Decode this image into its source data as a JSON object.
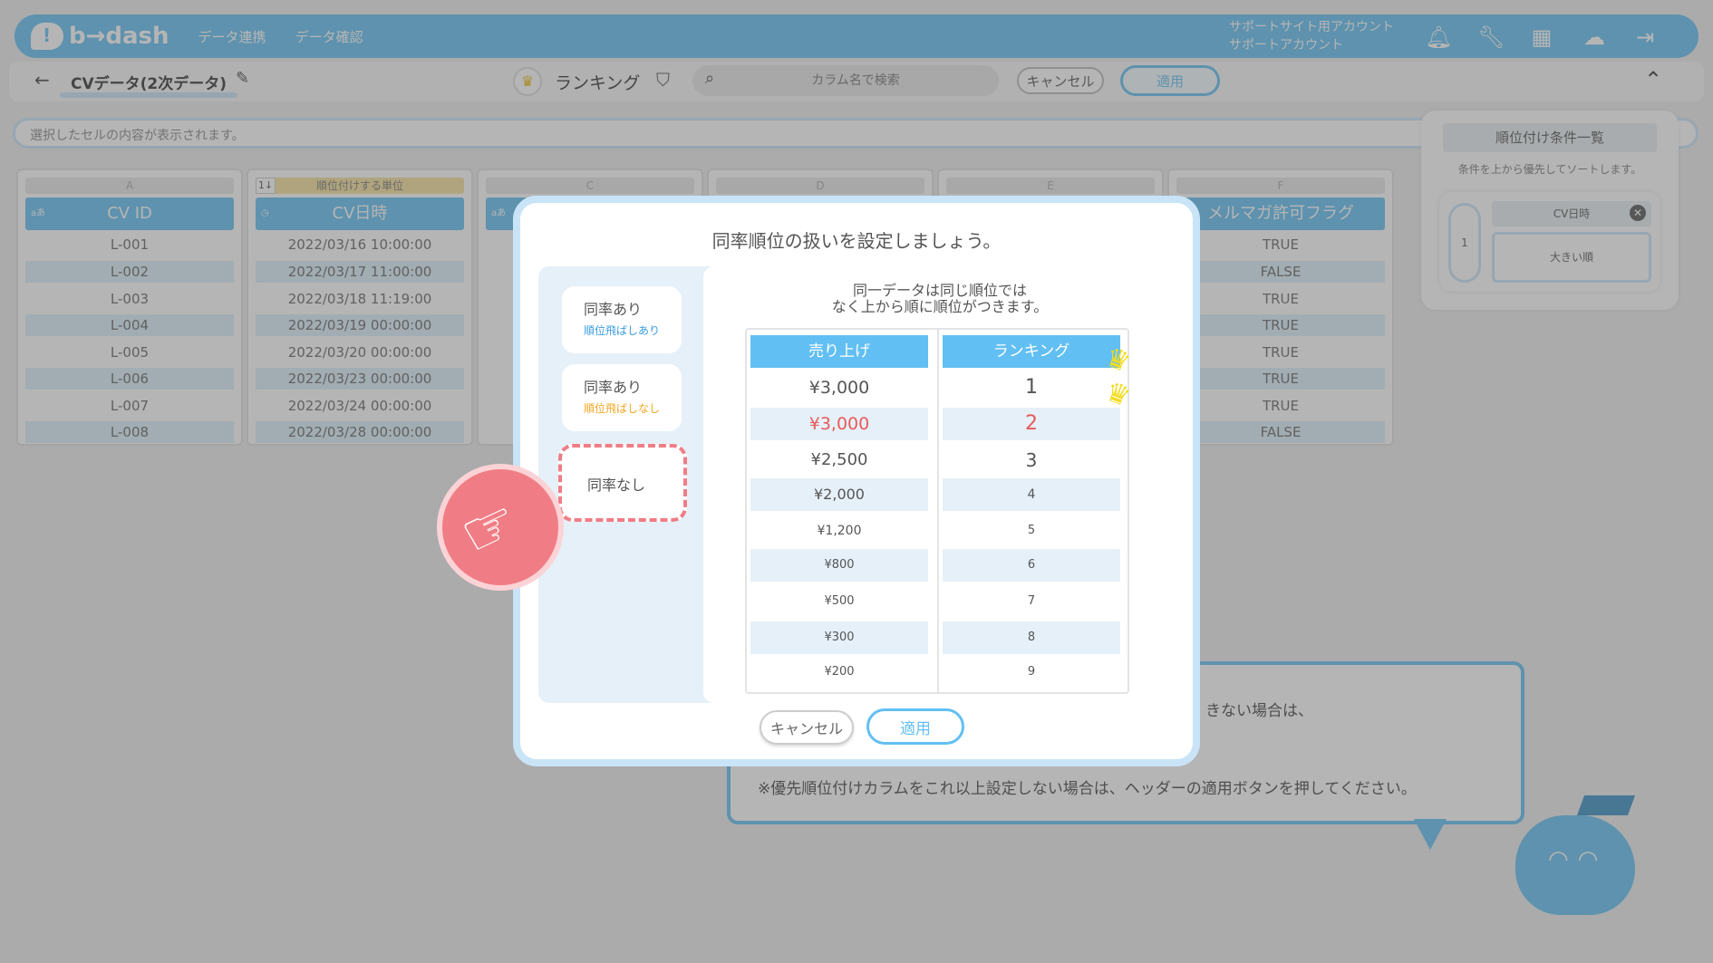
{
  "header": {
    "logo": "b→dash",
    "nav": [
      "データ連携",
      "データ確認"
    ],
    "account_line1": "サポートサイト用アカウント",
    "account_line2": "サポートアカウント",
    "icons": [
      "bell-icon",
      "wrench-icon",
      "grid-icon",
      "brain-icon",
      "logout-icon"
    ]
  },
  "subbar": {
    "dataset_title": "CVデータ(2次データ)",
    "mode_label": "ランキング",
    "search_placeholder": "カラム名で検索",
    "cancel_label": "キャンセル",
    "apply_label": "適用"
  },
  "cell_preview": "選択したセルの内容が表示されます。",
  "grid": {
    "columns": [
      {
        "letter": "A",
        "type": "aあ",
        "name": "CV ID",
        "values": [
          "L-001",
          "L-002",
          "L-003",
          "L-004",
          "L-005",
          "L-006",
          "L-007",
          "L-008"
        ]
      },
      {
        "letter": "B",
        "unit": "順位付けする単位",
        "unit_icon": "1↓",
        "name": "CV日時",
        "values": [
          "2022/03/16 10:00:00",
          "2022/03/17 11:00:00",
          "2022/03/18 11:19:00",
          "2022/03/19 00:00:00",
          "2022/03/20 00:00:00",
          "2022/03/23 00:00:00",
          "2022/03/24 00:00:00",
          "2022/03/28 00:00:00"
        ]
      },
      {
        "letter": "C",
        "type": "aあ",
        "name": "",
        "values": []
      },
      {
        "letter": "D",
        "name": "",
        "values": []
      },
      {
        "letter": "E",
        "name": "",
        "values": []
      },
      {
        "letter": "F",
        "type": "aあ",
        "name": "メルマガ許可フラグ",
        "values": [
          "TRUE",
          "FALSE",
          "TRUE",
          "TRUE",
          "TRUE",
          "TRUE",
          "TRUE",
          "FALSE"
        ]
      }
    ]
  },
  "conditions": {
    "title": "順位付け条件一覧",
    "subtitle": "条件を上から優先してソートします。",
    "items": [
      {
        "index": "1",
        "column": "CV日時",
        "order": "大きい順"
      }
    ]
  },
  "speech": {
    "line1": "きない場合は、",
    "line2": "※優先順位付けカラムをこれ以上設定しない場合は、ヘッダーの適用ボタンを押してください。"
  },
  "modal": {
    "title": "同率順位の扱いを設定しましょう。",
    "options": [
      {
        "label": "同率あり",
        "sub": "順位飛ばしあり"
      },
      {
        "label": "同率あり",
        "sub": "順位飛ばしなし"
      },
      {
        "label": "同率なし",
        "sub": ""
      }
    ],
    "selected_option": "同率なし",
    "description_line1": "同一データは同じ順位では",
    "description_line2": "なく上から順に順位がつきます。",
    "table": {
      "headers": [
        "売り上げ",
        "ランキング"
      ],
      "rows": [
        [
          "¥3,000",
          "1"
        ],
        [
          "¥3,000",
          "2"
        ],
        [
          "¥2,500",
          "3"
        ],
        [
          "¥2,000",
          "4"
        ],
        [
          "¥1,200",
          "5"
        ],
        [
          "¥800",
          "6"
        ],
        [
          "¥500",
          "7"
        ],
        [
          "¥300",
          "8"
        ],
        [
          "¥200",
          "9"
        ]
      ]
    },
    "cancel_label": "キャンセル",
    "apply_label": "適用"
  },
  "colors": {
    "accent": "#62bff3",
    "highlight_red": "#e85a5a",
    "dashed_select": "#f07d85",
    "crown": "#f3dc1f"
  }
}
